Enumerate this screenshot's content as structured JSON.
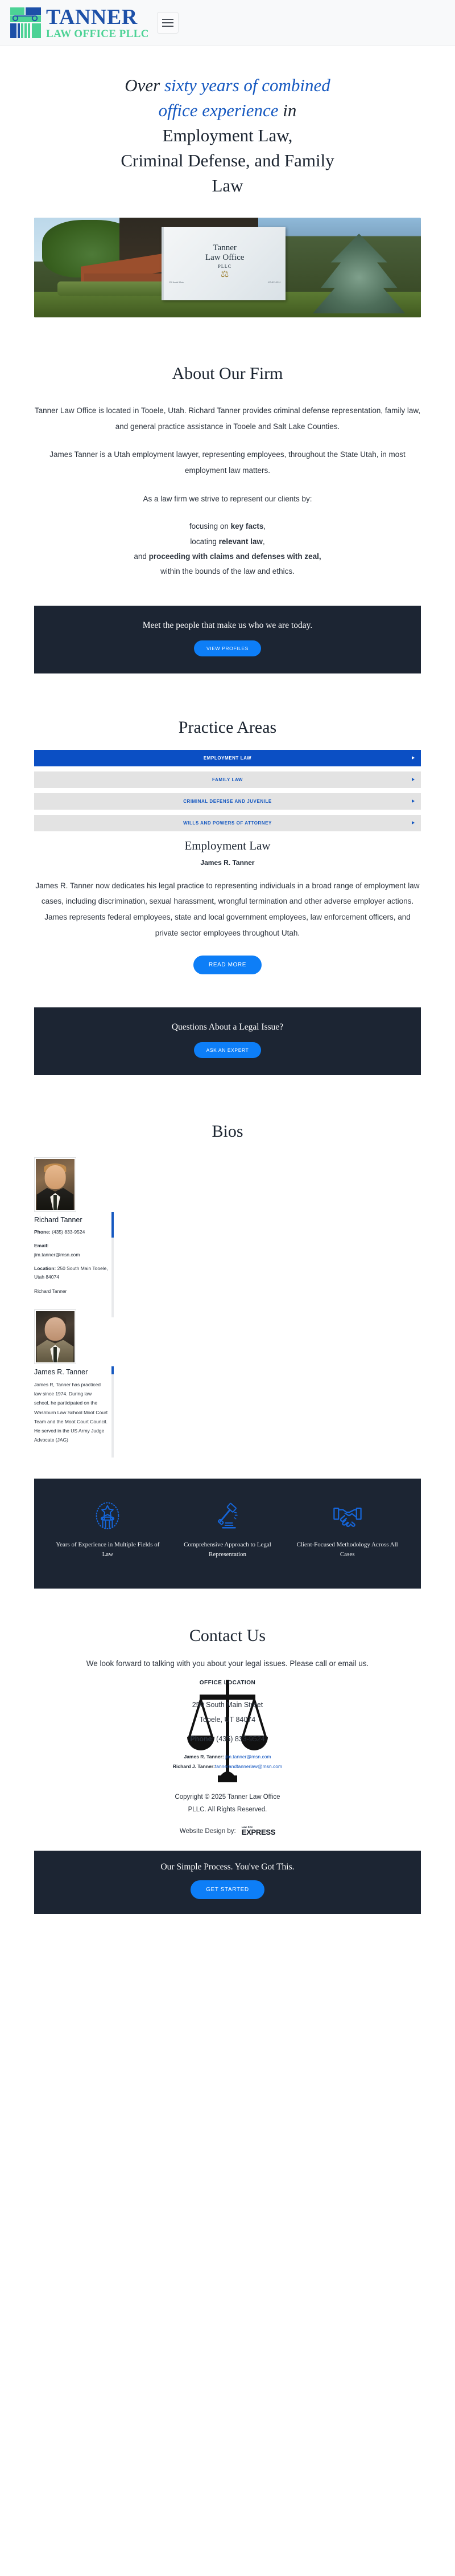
{
  "header": {
    "logo_title": "TANNER",
    "logo_subtitle": "LAW OFFICE PLLC",
    "menu_icon": "hamburger-menu-icon"
  },
  "hero": {
    "line1_pre": "Over ",
    "line1_blue": "sixty years of combined",
    "line2_blue": "office experience",
    "line2_post": " in",
    "line3": "Employment Law,",
    "line4": "Criminal Defense, and Family",
    "line5": "Law",
    "photo": {
      "sign_line1": "Tanner",
      "sign_line2": "Law Office",
      "sign_line3": "PLLC",
      "sign_address": "250 South Main",
      "sign_phone": "435-833-9524"
    }
  },
  "about": {
    "title": "About Our Firm",
    "p1": "Tanner Law Office is located in Tooele, Utah. Richard Tanner provides criminal defense representation, family law, and general practice assistance in Tooele and Salt Lake Counties.",
    "p2": "James Tanner is a Utah employment lawyer, representing employees, throughout the State Utah, in most employment law matters.",
    "p3": "As a law firm we strive to represent our clients by:",
    "bullets": {
      "b1_pre": "focusing on ",
      "b1_bold": "key facts",
      "b1_post": ",",
      "b2_pre": "locating ",
      "b2_bold": "relevant law",
      "b2_post": ",",
      "b3_pre": "and ",
      "b3_bold": "proceeding with claims and defenses with zeal,",
      "b4": "within the bounds of the law and ethics."
    }
  },
  "profiles_band": {
    "heading": "Meet the people that make us who we are today.",
    "button": "VIEW PROFILES"
  },
  "practice": {
    "title": "Practice Areas",
    "items": [
      {
        "label": "EMPLOYMENT LAW",
        "active": true
      },
      {
        "label": "FAMILY LAW",
        "active": false
      },
      {
        "label": "CRIMINAL DEFENSE AND JUVENILE",
        "active": false
      },
      {
        "label": "WILLS AND POWERS OF ATTORNEY",
        "active": false
      }
    ],
    "panel": {
      "heading": "Employment Law",
      "subheading": "James R. Tanner",
      "body": "James R. Tanner now dedicates his legal practice to representing individuals in a broad range of employment law cases, including discrimination, sexual harassment, wrongful termination and other adverse employer actions. James represents federal employees, state and local government employees, law enforcement officers, and private sector employees throughout Utah.",
      "button": "READ MORE"
    }
  },
  "questions_band": {
    "heading": "Questions About a Legal Issue?",
    "button": "ASK AN EXPERT"
  },
  "bios": {
    "title": "Bios",
    "people": [
      {
        "name": "Richard Tanner",
        "phone_label": "Phone:",
        "phone_value": " (435) 833-9524",
        "email_label": "Email:",
        "email_value": "jim.tanner@msn.com",
        "location_label": "Location:",
        "location_value": " 250 South Main Tooele, Utah 84074",
        "bio": "Richard Tanner"
      },
      {
        "name": "James R. Tanner",
        "bio": "James R, Tanner has practiced law since 1974.  During law school, he participated on the Washburn Law School Moot Court Team and the Moot Court Council.   He served in the US Army Judge Advocate (JAG)"
      }
    ]
  },
  "features": [
    {
      "icon": "pillar-star-icon",
      "text": "Years of Experience in Multiple Fields of Law"
    },
    {
      "icon": "gavel-icon",
      "text": "Comprehensive Approach to Legal Representation"
    },
    {
      "icon": "handshake-icon",
      "text": "Client-Focused Methodology Across All Cases"
    }
  ],
  "contact": {
    "title": "Contact Us",
    "intro": "We look forward to talking with you about your legal issues. Please call or email us.",
    "office_heading": "OFFICE LOCATION",
    "address_line1": "250 South Main Street",
    "address_line2": "Tooele, UT 84074",
    "phone_label": "Phone:",
    "phone_value": " (435) 833-9524",
    "email1_label": "James R. Tanner:",
    "email1_value": "jim.tanner@msn.com",
    "email2_label": "Richard J. Tanner:",
    "email2_value": "tannerandtannerlaw@msn.com",
    "watermark_icon": "scales-of-justice-icon"
  },
  "footer": {
    "copyright_line1": "Copyright © 2025 Tanner Law Office",
    "copyright_line2": "PLLC. All Rights Reserved.",
    "design_by_label": "Website Design by:",
    "design_by_brand_top": "Law Site",
    "design_by_brand_main": "EXPRESS",
    "band_heading": "Our Simple Process. You've Got This.",
    "band_button": "GET STARTED"
  },
  "colors": {
    "brand_blue": "#1d50a8",
    "brand_green": "#4cd295",
    "accent_blue": "#0d7ef7",
    "accordion_blue": "#0b4fc4",
    "dark": "#1c2533"
  }
}
